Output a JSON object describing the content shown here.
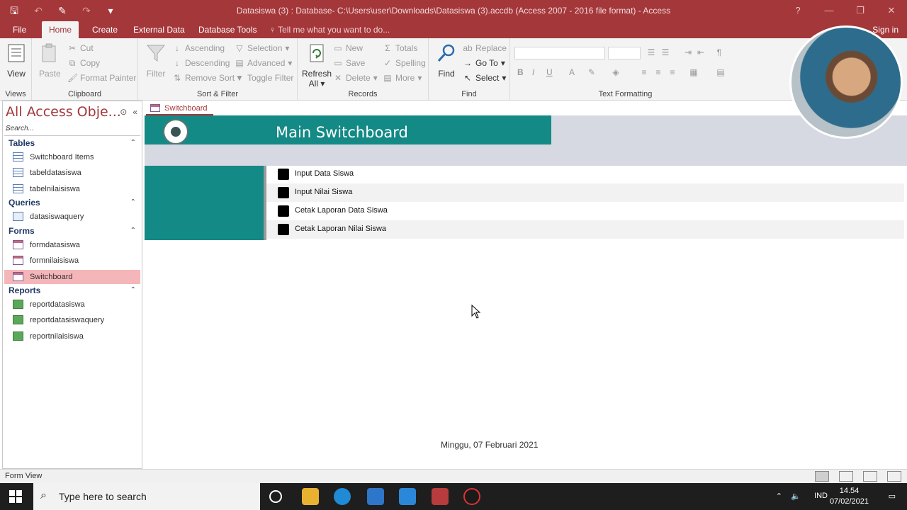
{
  "window": {
    "title": "Datasiswa (3) : Database- C:\\Users\\user\\Downloads\\Datasiswa (3).accdb (Access 2007 - 2016 file format) - Access",
    "help": "?",
    "minimize": "—",
    "restore": "❐",
    "close": "✕"
  },
  "ribbon_tabs": {
    "file": "File",
    "home": "Home",
    "create": "Create",
    "external": "External Data",
    "dbtools": "Database Tools",
    "tellme": "Tell me what you want to do...",
    "signin": "Sign in"
  },
  "ribbon": {
    "views": {
      "view": "View",
      "group": "Views"
    },
    "clipboard": {
      "paste": "Paste",
      "cut": "Cut",
      "copy": "Copy",
      "format_painter": "Format Painter",
      "group": "Clipboard"
    },
    "sort": {
      "filter": "Filter",
      "ascending": "Ascending",
      "descending": "Descending",
      "remove_sort": "Remove Sort",
      "selection": "Selection",
      "advanced": "Advanced",
      "toggle_filter": "Toggle Filter",
      "group": "Sort & Filter"
    },
    "records": {
      "refresh_line1": "Refresh",
      "refresh_line2": "All",
      "new": "New",
      "save": "Save",
      "delete": "Delete",
      "totals": "Totals",
      "spelling": "Spelling",
      "more": "More",
      "group": "Records"
    },
    "find": {
      "find": "Find",
      "replace": "Replace",
      "goto": "Go To",
      "select": "Select",
      "group": "Find"
    },
    "text": {
      "bold": "B",
      "italic": "I",
      "underline": "U",
      "group": "Text Formatting"
    }
  },
  "nav": {
    "header": "All Access Obje...",
    "search_placeholder": "Search...",
    "sections": [
      {
        "title": "Tables",
        "items": [
          "Switchboard Items",
          "tabeldatasiswa",
          "tabelnilaisiswa"
        ]
      },
      {
        "title": "Queries",
        "items": [
          "datasiswaquery"
        ]
      },
      {
        "title": "Forms",
        "items": [
          "formdatasiswa",
          "formnilaisiswa",
          "Switchboard"
        ]
      },
      {
        "title": "Reports",
        "items": [
          "reportdatasiswa",
          "reportdatasiswaquery",
          "reportnilaisiswa"
        ]
      }
    ]
  },
  "document": {
    "tab": "Switchboard",
    "title": "Main Switchboard",
    "menu": [
      "Input Data Siswa",
      "Input Nilai Siswa",
      "Cetak Laporan Data Siswa",
      "Cetak Laporan Nilai Siswa"
    ],
    "date": "Minggu, 07 Februari 2021"
  },
  "statusbar": {
    "text": "Form View"
  },
  "taskbar": {
    "search_placeholder": "Type here to search",
    "lang": "IND",
    "time": "14.54",
    "date": "07/02/2021"
  }
}
